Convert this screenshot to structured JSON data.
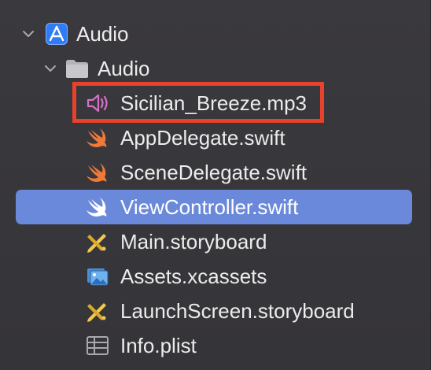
{
  "navigator": {
    "project": {
      "name": "Audio",
      "icon": "xcode-project-icon",
      "expanded": true
    },
    "group": {
      "name": "Audio",
      "icon": "folder-icon",
      "expanded": true
    },
    "files": [
      {
        "name": "Sicilian_Breeze.mp3",
        "icon": "speaker-icon",
        "highlighted": true
      },
      {
        "name": "AppDelegate.swift",
        "icon": "swift-icon"
      },
      {
        "name": "SceneDelegate.swift",
        "icon": "swift-icon"
      },
      {
        "name": "ViewController.swift",
        "icon": "swift-icon",
        "selected": true
      },
      {
        "name": "Main.storyboard",
        "icon": "storyboard-icon"
      },
      {
        "name": "Assets.xcassets",
        "icon": "asset-catalog-icon"
      },
      {
        "name": "LaunchScreen.storyboard",
        "icon": "storyboard-icon"
      },
      {
        "name": "Info.plist",
        "icon": "plist-icon"
      }
    ]
  },
  "colors": {
    "background": "#38373b",
    "selection": "#6b89db",
    "highlight_border": "#e8412c",
    "swift_orange": "#f0793a",
    "project_blue": "#2f7cf6",
    "speaker_pink": "#d670c4",
    "storyboard_yellow": "#f2c94c"
  }
}
